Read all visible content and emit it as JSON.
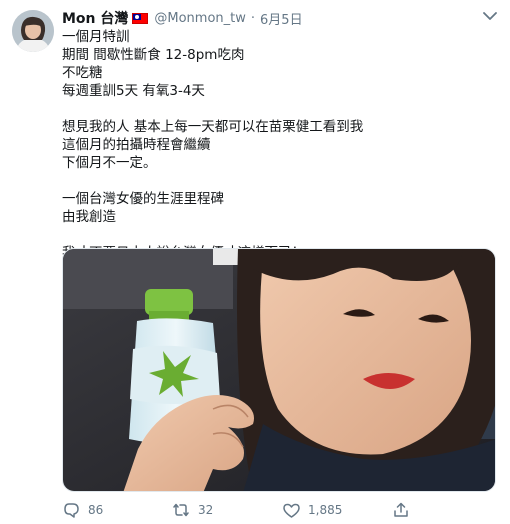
{
  "tweet": {
    "display_name": "Mon 台灣",
    "flag_icon": "taiwan-flag-icon",
    "handle": "@Monmon_tw",
    "separator": "·",
    "date": "6月5日",
    "more_icon": "chevron-down-icon",
    "lines": [
      "一個月特訓",
      "期間 間歇性斷食 12-8pm吃肉",
      "不吃糖",
      "每週重訓5天 有氧3-4天",
      "",
      "想見我的人 基本上每一天都可以在苗栗健工看到我",
      "這個月的拍攝時程會繼續",
      "下個月不一定。",
      "",
      "一個台灣女優的生涯里程碑",
      "由我創造",
      "",
      "我才不要日本人說台灣女優才這樣而已！"
    ],
    "media_alt_icon": "selfie-photo"
  },
  "actions": {
    "reply": {
      "icon": "reply-icon",
      "count": "86"
    },
    "retweet": {
      "icon": "retweet-icon",
      "count": "32"
    },
    "like": {
      "icon": "heart-icon",
      "count": "1,885"
    },
    "share": {
      "icon": "share-icon"
    }
  },
  "colors": {
    "text": "#14171a",
    "secondary": "#657786",
    "border": "#e1e8ed"
  }
}
